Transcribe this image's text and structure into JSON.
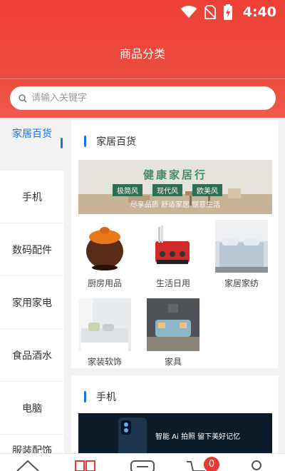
{
  "status_bar": {
    "time": "4:40"
  },
  "header": {
    "title": "商品分类"
  },
  "search": {
    "placeholder": "请输入关键字"
  },
  "sidebar": {
    "items": [
      {
        "label": "家居百货",
        "active": true
      },
      {
        "label": "手机"
      },
      {
        "label": "数码配件"
      },
      {
        "label": "家用家电"
      },
      {
        "label": "食品酒水"
      },
      {
        "label": "电脑"
      },
      {
        "label": "服装配饰"
      }
    ]
  },
  "sections": [
    {
      "title": "家居百货",
      "banner": {
        "headline": "健康家居行",
        "tags": [
          "极简风",
          "现代风",
          "欧美风"
        ],
        "subtitle": "尽享品质 舒适家居 惬意生活"
      },
      "items": [
        {
          "label": "厨房用品"
        },
        {
          "label": "生活日用"
        },
        {
          "label": "家居家纺"
        },
        {
          "label": "家装软饰"
        },
        {
          "label": "家具"
        }
      ]
    },
    {
      "title": "手机",
      "banner": {
        "headline": "智能 Ai 拍照 留下美好记忆"
      }
    }
  ],
  "tabbar": {
    "cart_badge": "0"
  },
  "colors": {
    "accent": "#1a73e8",
    "header": "#ee4037",
    "badge": "#e53935"
  }
}
